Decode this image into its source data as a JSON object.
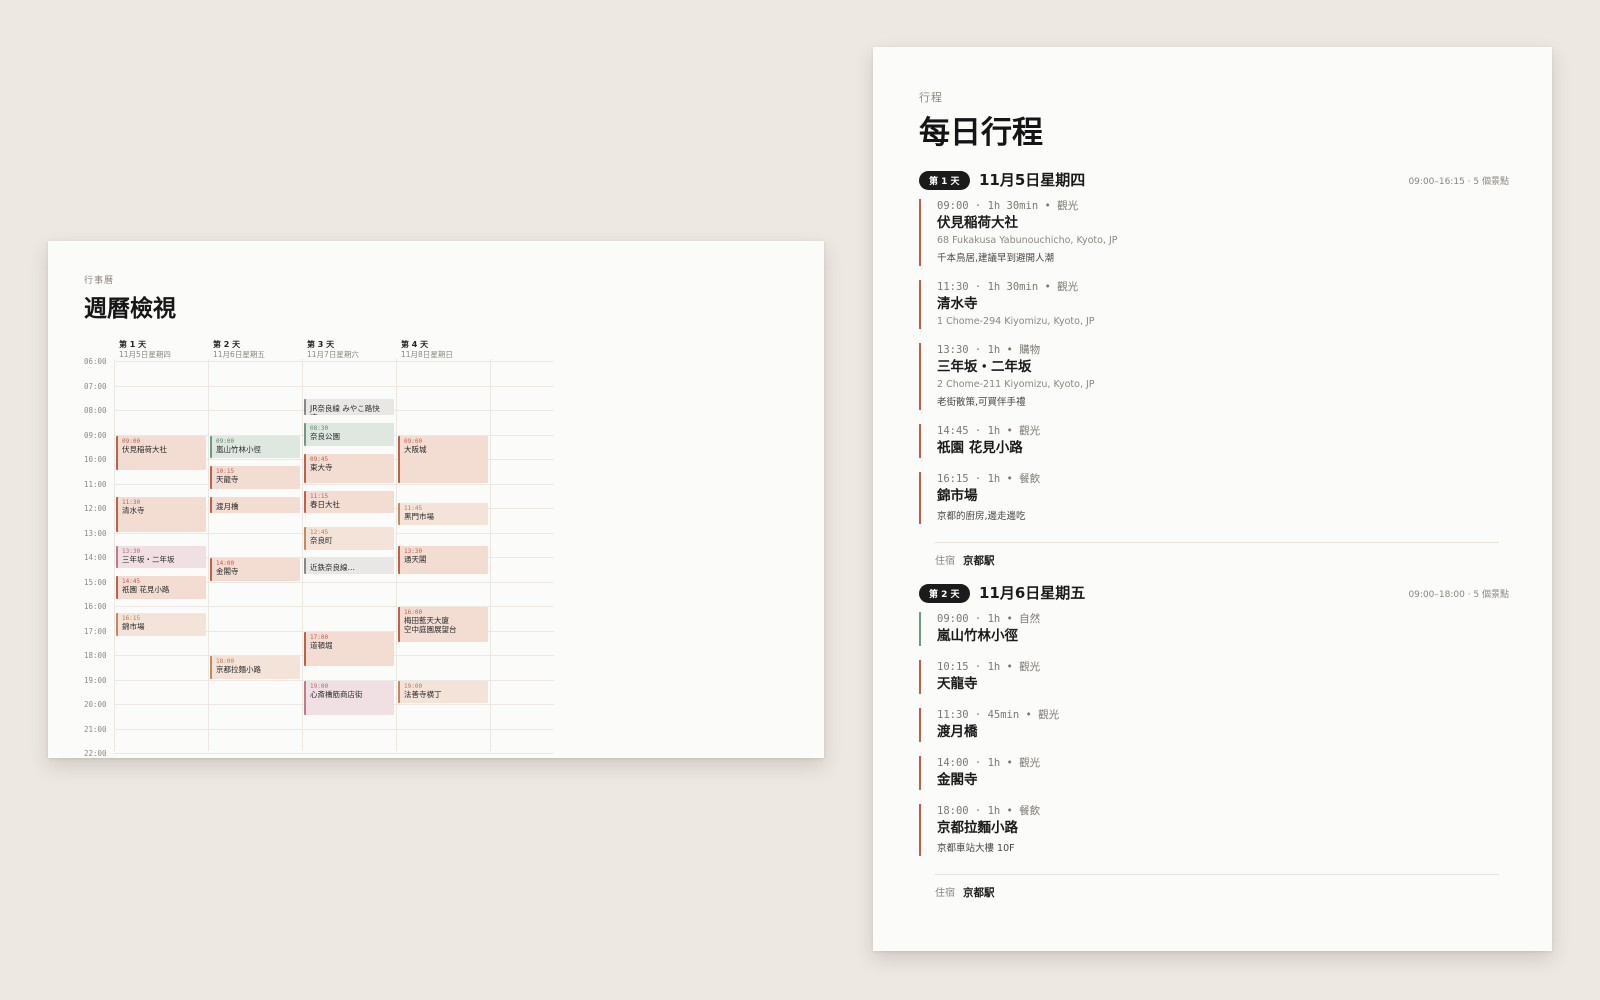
{
  "week": {
    "eyebrow": "行事曆",
    "title": "週曆檢視",
    "days": [
      {
        "label": "第 1 天",
        "date": "11月5日星期四"
      },
      {
        "label": "第 2 天",
        "date": "11月6日星期五"
      },
      {
        "label": "第 3 天",
        "date": "11月7日星期六"
      },
      {
        "label": "第 4 天",
        "date": "11月8日星期日"
      }
    ],
    "hours": [
      "06:00",
      "07:00",
      "08:00",
      "09:00",
      "10:00",
      "11:00",
      "12:00",
      "13:00",
      "14:00",
      "15:00",
      "16:00",
      "17:00",
      "18:00",
      "19:00",
      "20:00",
      "21:00",
      "22:00"
    ],
    "events": [
      {
        "day": 0,
        "start": 9.0,
        "end": 10.5,
        "time": "09:00",
        "name": "伏見稲荷大社",
        "cat": "sight"
      },
      {
        "day": 0,
        "start": 11.5,
        "end": 13.0,
        "time": "11:30",
        "name": "清水寺",
        "cat": "sight"
      },
      {
        "day": 0,
        "start": 13.5,
        "end": 14.5,
        "time": "13:30",
        "name": "三年坂・二年坂",
        "cat": "shop"
      },
      {
        "day": 0,
        "start": 14.75,
        "end": 15.75,
        "time": "14:45",
        "name": "祇園 花見小路",
        "cat": "sight"
      },
      {
        "day": 0,
        "start": 16.25,
        "end": 17.25,
        "time": "16:15",
        "name": "錦市場",
        "cat": "food"
      },
      {
        "day": 1,
        "start": 9.0,
        "end": 10.0,
        "time": "09:00",
        "name": "嵐山竹林小徑",
        "cat": "nature"
      },
      {
        "day": 1,
        "start": 10.25,
        "end": 11.25,
        "time": "10:15",
        "name": "天龍寺",
        "cat": "sight"
      },
      {
        "day": 1,
        "start": 11.5,
        "end": 12.25,
        "time": "",
        "name": "渡月橋",
        "cat": "sight"
      },
      {
        "day": 1,
        "start": 14.0,
        "end": 15.0,
        "time": "14:00",
        "name": "金閣寺",
        "cat": "sight"
      },
      {
        "day": 1,
        "start": 18.0,
        "end": 19.0,
        "time": "18:00",
        "name": "京都拉麵小路",
        "cat": "food"
      },
      {
        "day": 2,
        "start": 7.5,
        "end": 8.25,
        "time": "",
        "name": "JR奈良線 みやこ路快速…",
        "cat": "transit"
      },
      {
        "day": 2,
        "start": 8.5,
        "end": 9.5,
        "time": "08:30",
        "name": "奈良公園",
        "cat": "nature"
      },
      {
        "day": 2,
        "start": 9.75,
        "end": 11.0,
        "time": "09:45",
        "name": "東大寺",
        "cat": "sight"
      },
      {
        "day": 2,
        "start": 11.25,
        "end": 12.25,
        "time": "11:15",
        "name": "春日大社",
        "cat": "sight"
      },
      {
        "day": 2,
        "start": 12.75,
        "end": 13.75,
        "time": "12:45",
        "name": "奈良町",
        "cat": "food"
      },
      {
        "day": 2,
        "start": 14.0,
        "end": 14.75,
        "time": "",
        "name": "近鉄奈良線…",
        "cat": "transit"
      },
      {
        "day": 2,
        "start": 17.0,
        "end": 18.5,
        "time": "17:00",
        "name": "道頓堀",
        "cat": "sight"
      },
      {
        "day": 2,
        "start": 19.0,
        "end": 20.5,
        "time": "19:00",
        "name": "心斎橋筋商店街",
        "cat": "shop"
      },
      {
        "day": 3,
        "start": 9.0,
        "end": 11.0,
        "time": "09:00",
        "name": "大阪城",
        "cat": "sight"
      },
      {
        "day": 3,
        "start": 11.75,
        "end": 12.75,
        "time": "11:45",
        "name": "黑門市場",
        "cat": "food"
      },
      {
        "day": 3,
        "start": 13.5,
        "end": 14.75,
        "time": "13:30",
        "name": "通天閣",
        "cat": "sight"
      },
      {
        "day": 3,
        "start": 16.0,
        "end": 17.5,
        "time": "16:00",
        "name": "梅田藍天大廈\n空中庭園展望台",
        "cat": "sight"
      },
      {
        "day": 3,
        "start": 19.0,
        "end": 20.0,
        "time": "19:00",
        "name": "法善寺横丁",
        "cat": "food"
      }
    ]
  },
  "daily": {
    "eyebrow": "行程",
    "title": "每日行程",
    "sections": [
      {
        "badge": "第 1 天",
        "date": "11月5日星期四",
        "meta": "09:00–16:15 · 5 個景點",
        "stops": [
          {
            "meta": "09:00 · 1h 30min • 觀光",
            "name": "伏見稲荷大社",
            "addr": "68 Fukakusa Yabunouchicho, Kyoto, JP",
            "note": "千本鳥居,建議早到避開人潮",
            "cat": "sight"
          },
          {
            "meta": "11:30 · 1h 30min • 觀光",
            "name": "清水寺",
            "addr": "1 Chome-294 Kiyomizu, Kyoto, JP",
            "note": "",
            "cat": "sight"
          },
          {
            "meta": "13:30 · 1h • 購物",
            "name": "三年坂・二年坂",
            "addr": "2 Chome-211 Kiyomizu, Kyoto, JP",
            "note": "老街散策,可買伴手禮",
            "cat": "shop"
          },
          {
            "meta": "14:45 · 1h • 觀光",
            "name": "祇園 花見小路",
            "addr": "",
            "note": "",
            "cat": "sight"
          },
          {
            "meta": "16:15 · 1h • 餐飲",
            "name": "錦市場",
            "addr": "",
            "note": "京都的廚房,邊走邊吃",
            "cat": "food"
          }
        ],
        "stay_label": "住宿",
        "stay_value": "京都駅"
      },
      {
        "badge": "第 2 天",
        "date": "11月6日星期五",
        "meta": "09:00–18:00 · 5 個景點",
        "stops": [
          {
            "meta": "09:00 · 1h • 自然",
            "name": "嵐山竹林小徑",
            "addr": "",
            "note": "",
            "cat": "nature"
          },
          {
            "meta": "10:15 · 1h • 觀光",
            "name": "天龍寺",
            "addr": "",
            "note": "",
            "cat": "sight"
          },
          {
            "meta": "11:30 · 45min • 觀光",
            "name": "渡月橋",
            "addr": "",
            "note": "",
            "cat": "sight"
          },
          {
            "meta": "14:00 · 1h • 觀光",
            "name": "金閣寺",
            "addr": "",
            "note": "",
            "cat": "sight"
          },
          {
            "meta": "18:00 · 1h • 餐飲",
            "name": "京都拉麵小路",
            "addr": "",
            "note": "京都車站大樓 10F",
            "cat": "food"
          }
        ],
        "stay_label": "住宿",
        "stay_value": "京都駅"
      }
    ]
  }
}
